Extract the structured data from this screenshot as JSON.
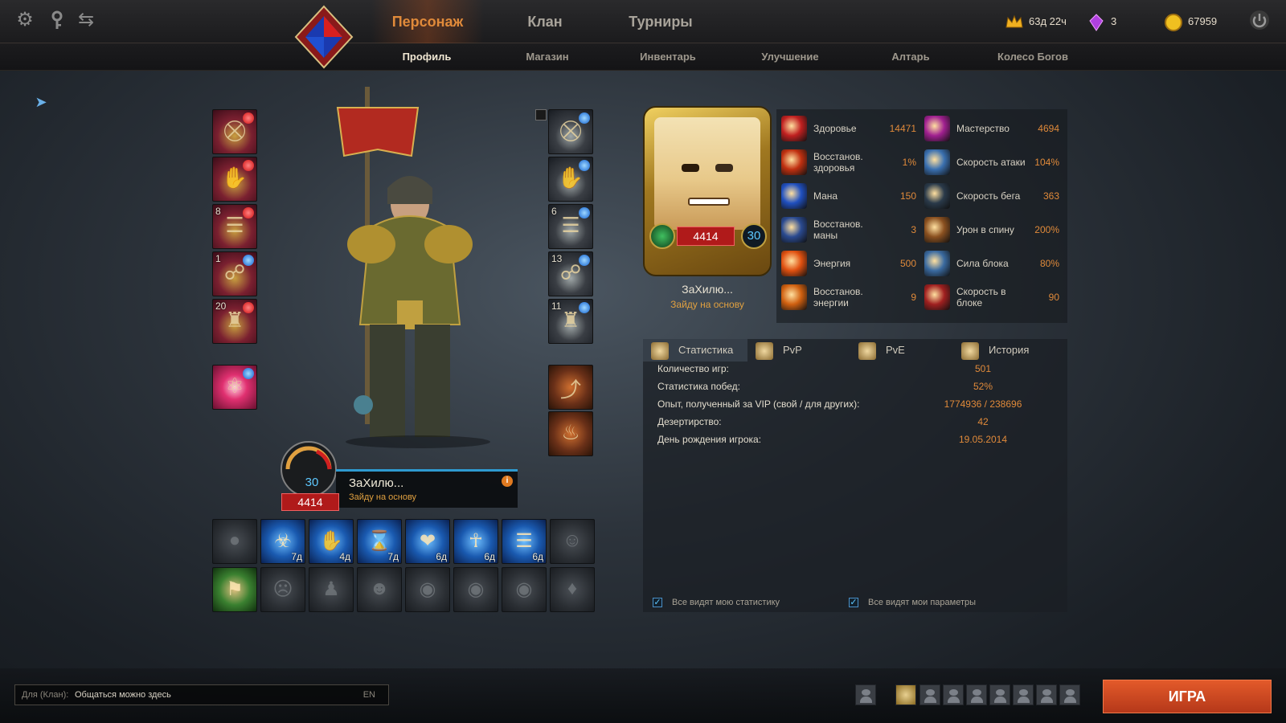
{
  "colors": {
    "accent": "#e08a3a",
    "level_blue": "#5ec8ff",
    "rating_red": "#b01a1a",
    "play_button": "#d14a22"
  },
  "system_icons": [
    "gear-icon",
    "key-icon",
    "swap-icon"
  ],
  "main_tabs": [
    {
      "label": "Персонаж",
      "active": true
    },
    {
      "label": "Клан",
      "active": false
    },
    {
      "label": "Турниры",
      "active": false
    }
  ],
  "sub_tabs": [
    {
      "label": "Профиль",
      "active": true
    },
    {
      "label": "Магазин",
      "active": false
    },
    {
      "label": "Инвентарь",
      "active": false
    },
    {
      "label": "Улучшение",
      "active": false
    },
    {
      "label": "Алтарь",
      "active": false
    },
    {
      "label": "Колесо Богов",
      "active": false
    }
  ],
  "resources": {
    "premium_time": "63д 22ч",
    "crystals": "3",
    "gold": "67959"
  },
  "equipment_left": [
    {
      "icon": "shoulder-armor-icon",
      "level": "",
      "gem": "red"
    },
    {
      "icon": "gauntlet-icon",
      "level": "",
      "gem": "red"
    },
    {
      "icon": "bracer-icon",
      "level": "8",
      "gem": "red"
    },
    {
      "icon": "belt-icon",
      "level": "1",
      "gem": "blue"
    },
    {
      "icon": "boots-icon",
      "level": "20",
      "gem": "red"
    }
  ],
  "equipment_right": [
    {
      "icon": "cloak-icon",
      "level": "",
      "gem": "blue"
    },
    {
      "icon": "chest-armor-icon",
      "level": "",
      "gem": "blue"
    },
    {
      "icon": "armguard-icon",
      "level": "6",
      "gem": "blue"
    },
    {
      "icon": "necklace-icon",
      "level": "13",
      "gem": "blue"
    },
    {
      "icon": "helmet-icon",
      "level": "11",
      "gem": "blue"
    }
  ],
  "hero": {
    "name": "ЗаХилю...",
    "status": "Зайду на основу",
    "rating": "4414",
    "level": "30"
  },
  "talents_row1": [
    {
      "icon": "locked-talent-icon",
      "duration": ""
    },
    {
      "icon": "wolf-head-icon",
      "duration": "7д"
    },
    {
      "icon": "golden-hand-icon",
      "duration": "4д"
    },
    {
      "icon": "hourglass-icon",
      "duration": "7д"
    },
    {
      "icon": "heart-icon",
      "duration": "6д"
    },
    {
      "icon": "ankh-icon",
      "duration": "6д"
    },
    {
      "icon": "book-icon",
      "duration": "6д"
    },
    {
      "icon": "mask-icon",
      "duration": ""
    }
  ],
  "talents_row2": [
    {
      "icon": "banner-icon",
      "duration": ""
    },
    {
      "icon": "skull-face-icon",
      "duration": ""
    },
    {
      "icon": "silhouette-icon",
      "duration": ""
    },
    {
      "icon": "hair-icon",
      "duration": ""
    },
    {
      "icon": "bag-icon",
      "duration": ""
    },
    {
      "icon": "bag-icon",
      "duration": ""
    },
    {
      "icon": "bag-icon",
      "duration": ""
    },
    {
      "icon": "cape-icon",
      "duration": ""
    }
  ],
  "stats": [
    {
      "label": "Здоровье",
      "value": "14471",
      "icon": "health-icon",
      "color": "#c02020"
    },
    {
      "label": "Восстанов. здоровья",
      "value": "1%",
      "icon": "health-regen-icon",
      "color": "#c03010"
    },
    {
      "label": "Мана",
      "value": "150",
      "icon": "mana-icon",
      "color": "#2050c0"
    },
    {
      "label": "Восстанов. маны",
      "value": "3",
      "icon": "mana-regen-icon",
      "color": "#2a4a90"
    },
    {
      "label": "Энергия",
      "value": "500",
      "icon": "energy-icon",
      "color": "#e05010"
    },
    {
      "label": "Восстанов. энергии",
      "value": "9",
      "icon": "energy-regen-icon",
      "color": "#d06010"
    },
    {
      "label": "Мастерство",
      "value": "4694",
      "icon": "mastery-icon",
      "color": "#a02090"
    },
    {
      "label": "Скорость атаки",
      "value": "104%",
      "icon": "attack-speed-icon",
      "color": "#3a70b0"
    },
    {
      "label": "Скорость бега",
      "value": "363",
      "icon": "run-speed-icon",
      "color": "#2a3a4a"
    },
    {
      "label": "Урон в спину",
      "value": "200%",
      "icon": "backstab-icon",
      "color": "#8a5020"
    },
    {
      "label": "Сила блока",
      "value": "80%",
      "icon": "block-power-icon",
      "color": "#3a6aa0"
    },
    {
      "label": "Скорость в блоке",
      "value": "90",
      "icon": "block-speed-icon",
      "color": "#a02020"
    }
  ],
  "panel_tabs": [
    {
      "label": "Статистика",
      "icon": "scroll-icon",
      "active": true
    },
    {
      "label": "PvP",
      "icon": "crossed-swords-icon",
      "active": false
    },
    {
      "label": "PvE",
      "icon": "shield-icon",
      "active": false
    },
    {
      "label": "История",
      "icon": "parchment-icon",
      "active": false
    }
  ],
  "statistics": [
    {
      "label": "Количество игр:",
      "value": "501"
    },
    {
      "label": "Статистика побед:",
      "value": "52%"
    },
    {
      "label": "Опыт, полученный за VIP (свой / для других):",
      "value": "1774936 / 238696"
    },
    {
      "label": "Дезертирство:",
      "value": "42"
    },
    {
      "label": "День рождения игрока:",
      "value": "19.05.2014"
    }
  ],
  "privacy": {
    "stats_visible": "Все видят мою статистику",
    "params_visible": "Все видят мои параметры"
  },
  "chat": {
    "prefix": "Для (Клан):",
    "placeholder": "Общаться можно здесь",
    "lang": "EN"
  },
  "play_button": "ИГРА"
}
